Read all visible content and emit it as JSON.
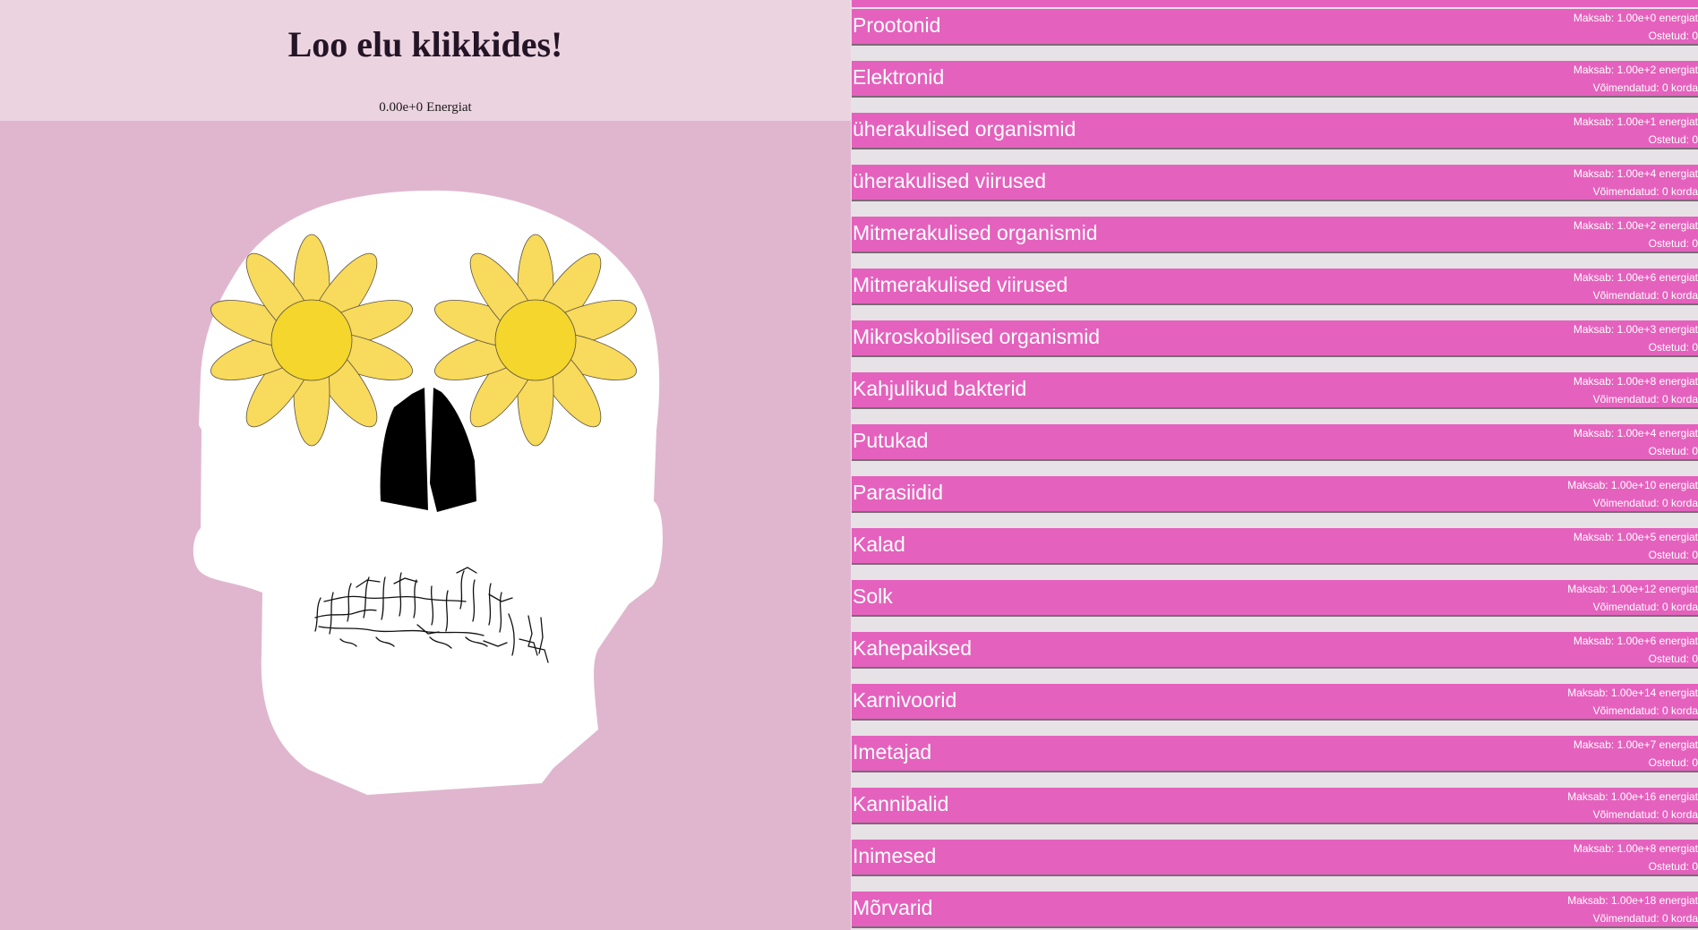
{
  "header": {
    "title": "Loo elu klikkides!",
    "energy_value": "0.00e+0",
    "energy_unit": "Energiat"
  },
  "colors": {
    "header_bg": "#ecd3e0",
    "page_bg": "#e0b6cf",
    "item_bg": "#e462bd",
    "flower_petal": "#f8da5c",
    "flower_center": "#f4d62c"
  },
  "shop": {
    "items": [
      {
        "name": "Prootonid",
        "cost": "Maksab: 1.00e+0 energiat",
        "status": "Ostetud: 0"
      },
      {
        "name": "Elektronid",
        "cost": "Maksab: 1.00e+2 energiat",
        "status": "Võimendatud: 0 korda"
      },
      {
        "name": "üherakulised organismid",
        "cost": "Maksab: 1.00e+1 energiat",
        "status": "Ostetud: 0"
      },
      {
        "name": "üherakulised viirused",
        "cost": "Maksab: 1.00e+4 energiat",
        "status": "Võimendatud: 0 korda"
      },
      {
        "name": "Mitmerakulised organismid",
        "cost": "Maksab: 1.00e+2 energiat",
        "status": "Ostetud: 0"
      },
      {
        "name": "Mitmerakulised viirused",
        "cost": "Maksab: 1.00e+6 energiat",
        "status": "Võimendatud: 0 korda"
      },
      {
        "name": "Mikroskobilised organismid",
        "cost": "Maksab: 1.00e+3 energiat",
        "status": "Ostetud: 0"
      },
      {
        "name": "Kahjulikud bakterid",
        "cost": "Maksab: 1.00e+8 energiat",
        "status": "Võimendatud: 0 korda"
      },
      {
        "name": "Putukad",
        "cost": "Maksab: 1.00e+4 energiat",
        "status": "Ostetud: 0"
      },
      {
        "name": "Parasiidid",
        "cost": "Maksab: 1.00e+10 energiat",
        "status": "Võimendatud: 0 korda"
      },
      {
        "name": "Kalad",
        "cost": "Maksab: 1.00e+5 energiat",
        "status": "Ostetud: 0"
      },
      {
        "name": "Solk",
        "cost": "Maksab: 1.00e+12 energiat",
        "status": "Võimendatud: 0 korda"
      },
      {
        "name": "Kahepaiksed",
        "cost": "Maksab: 1.00e+6 energiat",
        "status": "Ostetud: 0"
      },
      {
        "name": "Karnivoorid",
        "cost": "Maksab: 1.00e+14 energiat",
        "status": "Võimendatud: 0 korda"
      },
      {
        "name": "Imetajad",
        "cost": "Maksab: 1.00e+7 energiat",
        "status": "Ostetud: 0"
      },
      {
        "name": "Kannibalid",
        "cost": "Maksab: 1.00e+16 energiat",
        "status": "Võimendatud: 0 korda"
      },
      {
        "name": "Inimesed",
        "cost": "Maksab: 1.00e+8 energiat",
        "status": "Ostetud: 0"
      },
      {
        "name": "Mõrvarid",
        "cost": "Maksab: 1.00e+18 energiat",
        "status": "Võimendatud: 0 korda"
      }
    ]
  }
}
